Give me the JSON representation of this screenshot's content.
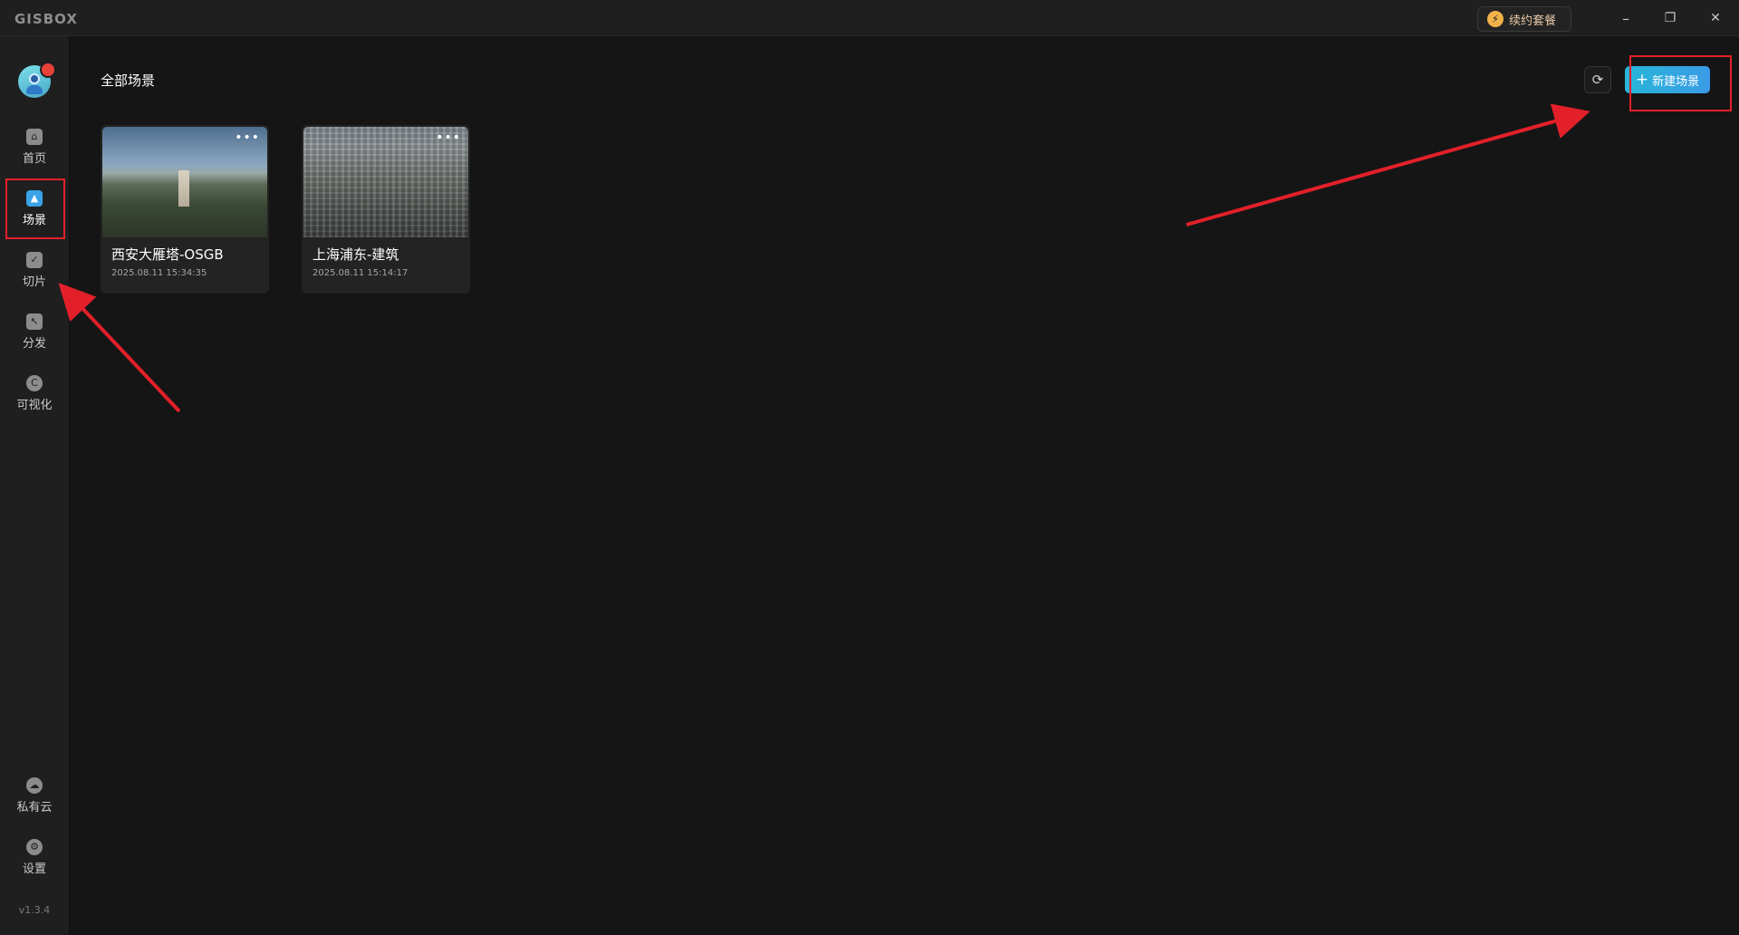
{
  "app": {
    "logo_text": "GISBOX",
    "renew_label": "续约套餐",
    "window_controls": {
      "minimize": "–",
      "restore": "❐",
      "close": "✕"
    }
  },
  "sidebar": {
    "items": [
      {
        "label": "首页",
        "icon": "home-icon",
        "active": false
      },
      {
        "label": "场景",
        "icon": "scene-cube-icon",
        "active": true
      },
      {
        "label": "切片",
        "icon": "slice-doc-icon",
        "active": false
      },
      {
        "label": "分发",
        "icon": "distribute-icon",
        "active": false
      },
      {
        "label": "可视化",
        "icon": "visualization-icon",
        "active": false
      }
    ],
    "bottom_items": [
      {
        "label": "私有云",
        "icon": "private-cloud-icon"
      },
      {
        "label": "设置",
        "icon": "settings-gear-icon"
      }
    ],
    "version": "v1.3.4"
  },
  "main": {
    "title": "全部场景",
    "refresh_icon": "⟳",
    "new_scene_label": "新建场景",
    "new_scene_plus": "+",
    "scenes": [
      {
        "name": "西安大雁塔-OSGB",
        "date": "2025.08.11 15:34:35",
        "menu": "•••"
      },
      {
        "name": "上海浦东-建筑",
        "date": "2025.08.11 15:14:17",
        "menu": "•••"
      }
    ]
  },
  "colors": {
    "background": "#151515",
    "sidebar": "#1f1f1f",
    "accent": "#3aa3e8",
    "annotation_red": "#e3202a"
  }
}
